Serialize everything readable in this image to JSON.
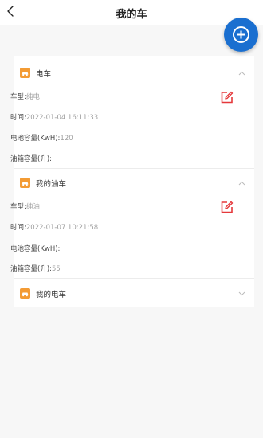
{
  "header": {
    "title": "我的车"
  },
  "colors": {
    "accent": "#1a6fd0",
    "edit": "#e5383b",
    "icon_orange": "#f39b34"
  },
  "groups": [
    {
      "name": "电车",
      "expanded": true,
      "fields": [
        {
          "label": "车型:",
          "value": "纯电"
        },
        {
          "label": "时间:",
          "value": "2022-01-04 16:11:33"
        },
        {
          "label": "电池容量(KwH):",
          "value": "120"
        },
        {
          "label": "油箱容量(升):",
          "value": ""
        }
      ]
    },
    {
      "name": "我的油车",
      "expanded": true,
      "fields": [
        {
          "label": "车型:",
          "value": "纯油"
        },
        {
          "label": "时间:",
          "value": "2022-01-07 10:21:58"
        },
        {
          "label": "电池容量(KwH):",
          "value": ""
        },
        {
          "label": "油箱容量(升):",
          "value": "55"
        }
      ]
    },
    {
      "name": "我的电车",
      "expanded": false,
      "fields": []
    }
  ]
}
